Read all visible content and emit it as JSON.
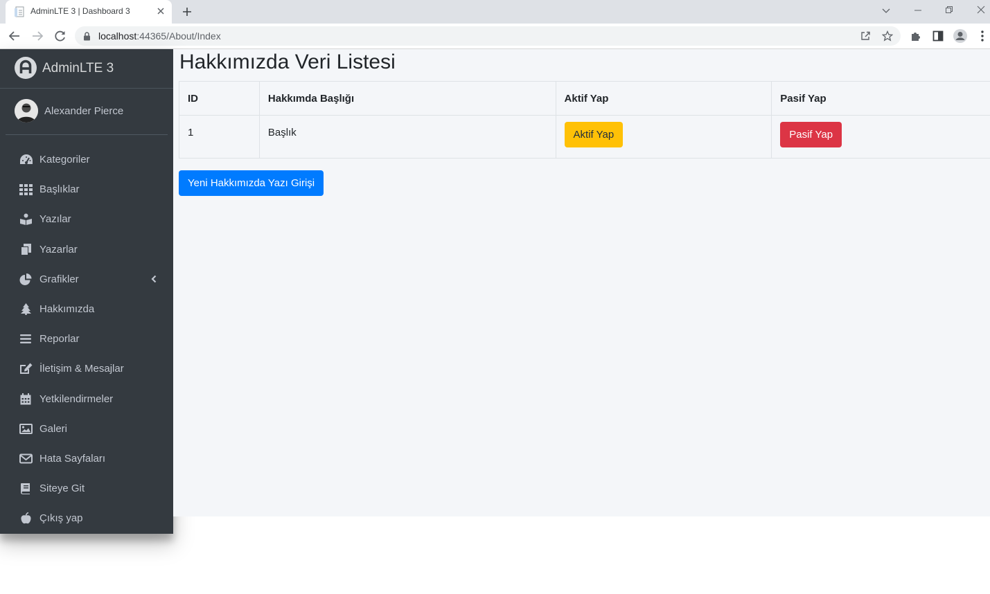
{
  "browser": {
    "tab_title": "AdminLTE 3 | Dashboard 3",
    "url_host": "localhost",
    "url_rest": ":44365/About/Index"
  },
  "sidebar": {
    "brand": "AdminLTE 3",
    "user_name": "Alexander Pierce",
    "items": [
      {
        "label": "Kategoriler",
        "icon": "tachometer-icon"
      },
      {
        "label": "Başlıklar",
        "icon": "th-grid-icon"
      },
      {
        "label": "Yazılar",
        "icon": "book-reader-icon"
      },
      {
        "label": "Yazarlar",
        "icon": "copy-icon"
      },
      {
        "label": "Grafikler",
        "icon": "chart-pie-icon"
      },
      {
        "label": "Hakkımızda",
        "icon": "tree-icon"
      },
      {
        "label": "Reporlar",
        "icon": "bars-icon"
      },
      {
        "label": "İletişim & Mesajlar",
        "icon": "edit-icon"
      },
      {
        "label": "Yetkilendirmeler",
        "icon": "calendar-icon"
      },
      {
        "label": "Galeri",
        "icon": "image-icon"
      },
      {
        "label": "Hata Sayfaları",
        "icon": "envelope-icon"
      },
      {
        "label": "Siteye Git",
        "icon": "book-icon"
      },
      {
        "label": "Çıkış yap",
        "icon": "apple-icon"
      }
    ]
  },
  "main": {
    "title": "Hakkımızda Veri Listesi",
    "table": {
      "headers": [
        "ID",
        "Hakkımda Başlığı",
        "Aktif Yap",
        "Pasif Yap"
      ],
      "rows": [
        {
          "id": "1",
          "title": "Başlık",
          "activate_label": "Aktif Yap",
          "deactivate_label": "Pasif Yap"
        }
      ]
    },
    "new_button_label": "Yeni Hakkımızda Yazı Girişi"
  },
  "colors": {
    "sidebar_bg": "#343a40",
    "content_bg": "#f4f6f9",
    "warning": "#ffc107",
    "danger": "#dc3545",
    "primary": "#007bff"
  }
}
